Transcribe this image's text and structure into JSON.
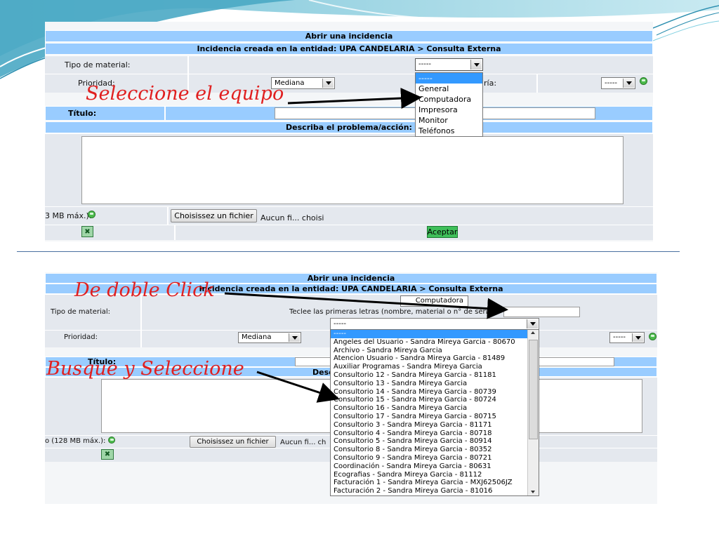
{
  "top": {
    "header_title": "Abrir una incidencia",
    "header_entity": "Incidencia creada en la entidad: UPA CANDELARIA > Consulta Externa",
    "tipo_material_label": "Tipo de material:",
    "tipo_select_value": "-----",
    "prioridad_label": "Prioridad:",
    "prioridad_value": "Mediana",
    "categoria_partial": "ría:",
    "categoria_value": "-----",
    "titulo_label": "Título:",
    "describe_label": "Describa el problema/acción:",
    "attach_label_partial": "3 MB máx.):",
    "file_button": "Choisissez un fichier",
    "file_status": "Aucun fi... choisi",
    "aceptar_button": "Aceptar",
    "dropdown_items": [
      "-----",
      "General",
      "Computadora",
      "Impresora",
      "Monitor",
      "Teléfonos"
    ],
    "dropdown_selected_index": 0
  },
  "bottom": {
    "header_title": "Abrir una incidencia",
    "header_entity": "Incidencia creada en la entidad: UPA CANDELARIA > Consulta Externa",
    "tipo_material_label": "Tipo de material:",
    "tipo_value": "Computadora",
    "search_hint": "Teclee las primeras letras (nombre, material o n° de serie)",
    "search_star": "*",
    "equipo_select_value": "-----",
    "prioridad_label": "Prioridad:",
    "prioridad_value": "Mediana",
    "right_select_value": "-----",
    "titulo_label": "Título:",
    "desc_partial": "Desc",
    "attach_label_partial": "o (128 MB máx.):",
    "file_button": "Choisissez un fichier",
    "file_status": "Aucun fi... ch",
    "list_items": [
      "-----",
      "Angeles del Usuario - Sandra Mireya Garcia - 80670",
      "Archivo - Sandra Mireya Garcia",
      "Atencion Usuario - Sandra Mireya Garcia - 81489",
      "Auxiliar Programas - Sandra Mireya Garcia",
      "Consultorio 12 - Sandra Mireya Garcia - 81181",
      "Consultorio 13 - Sandra Mireya Garcia",
      "Consultorio 14 - Sandra Mireya Garcia - 80739",
      "Consultorio 15 - Sandra Mireya Garcia - 80724",
      "Consultorio 16 - Sandra Mireya Garcia",
      "Consultorio 17 - Sandra Mireya Garcia - 80715",
      "Consultorio 3 - Sandra Mireya Garcia - 81171",
      "Consultorio 4 - Sandra Mireya Garcia - 80718",
      "Consultorio 5 - Sandra Mireya Garcia - 80914",
      "Consultorio 8 - Sandra Mireya Garcia - 80352",
      "Consultorio 9 - Sandra Mireya Garcia - 80721",
      "Coordinación - Sandra Mireya Garcia - 80631",
      "Ecografias - Sandra Mireya Garcia - 81112",
      "Facturación 1 - Sandra Mireya Garcia - MXJ62506JZ",
      "Facturación 2 - Sandra Mireya Garcia - 81016"
    ],
    "list_selected_index": 0
  },
  "annotations": {
    "select_equipo": "Seleccione el equipo",
    "doble_click": "De doble Click",
    "busque": "Busque y Seleccione"
  },
  "colors": {
    "header_blue": "#99ccff",
    "row_gray": "#e4e8ee",
    "annotation_red": "#e02020",
    "highlight_blue": "#3399ff"
  }
}
